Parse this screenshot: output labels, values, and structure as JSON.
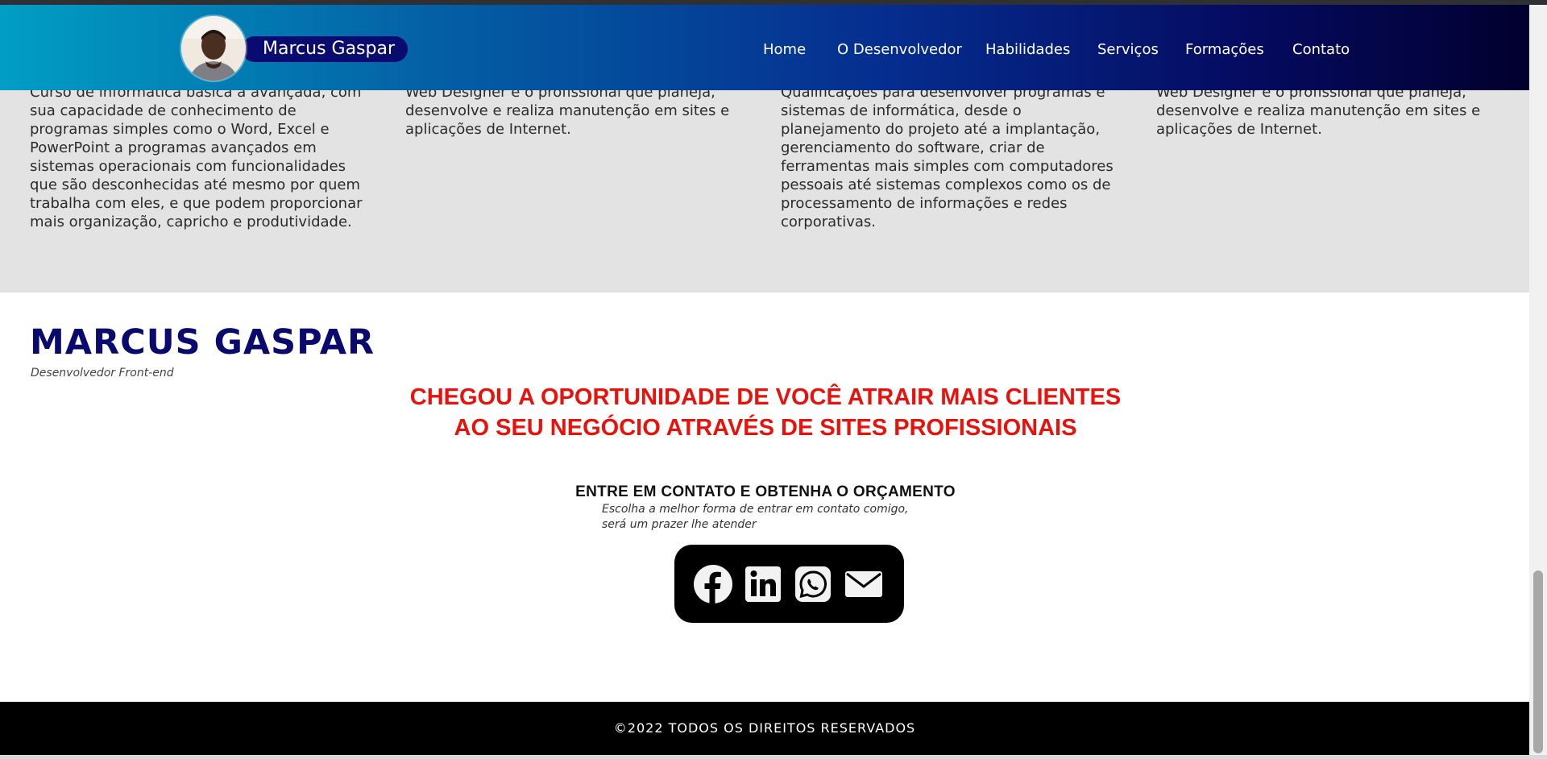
{
  "header": {
    "brand_name": "Marcus Gaspar",
    "nav": [
      {
        "label": "Home"
      },
      {
        "label": "O Desenvolvedor"
      },
      {
        "label": "Habilidades"
      },
      {
        "label": "Serviços"
      },
      {
        "label": "Formações"
      },
      {
        "label": "Contato"
      }
    ],
    "gradient_colors": [
      "#009ec4",
      "#052d8f",
      "#02002e"
    ],
    "pill_color": "#0a0b70"
  },
  "services": [
    {
      "text": "Curso de informática básica a avançada, com sua capacidade de conhecimento de programas simples como o Word, Excel e PowerPoint a programas avançados em sistemas operacionais com funcionalidades que são desconhecidas até mesmo por quem trabalha com eles, e que podem proporcionar mais organização, capricho e produtividade."
    },
    {
      "text": "Web Designer é o profissional que planeja, desenvolve e realiza manutenção em sites e aplicações de Internet."
    },
    {
      "text": "Qualificações para desenvolver programas e sistemas de informática, desde o planejamento do projeto até a implantação,  gerenciamento do software, criar de ferramentas mais simples com computadores pessoais até sistemas complexos como os de processamento de informações e redes corporativas."
    },
    {
      "text": "Web Designer é o profissional que planeja, desenvolve e realiza manutenção em sites e aplicações de Internet."
    }
  ],
  "main": {
    "title": "MARCUS GASPAR",
    "subtitle": "Desenvolvedor Front-end",
    "headline_line1": "CHEGOU A OPORTUNIDADE DE VOCÊ ATRAIR MAIS CLIENTES",
    "headline_line2": "AO SEU NEGÓCIO ATRAVÉS DE SITES PROFISSIONAIS",
    "headline_color": "#e8120c",
    "title_color": "#0a0a6e"
  },
  "contact": {
    "title": "ENTRE EM CONTATO E OBTENHA O ORÇAMENTO",
    "desc_line1": "Escolha a melhor forma de entrar em contato comigo,",
    "desc_line2": "será um prazer lhe atender",
    "icons": [
      "facebook-icon",
      "linkedin-icon",
      "whatsapp-icon",
      "email-icon"
    ]
  },
  "footer": {
    "copyright": "©2022 TODOS OS DIREITOS RESERVADOS"
  }
}
